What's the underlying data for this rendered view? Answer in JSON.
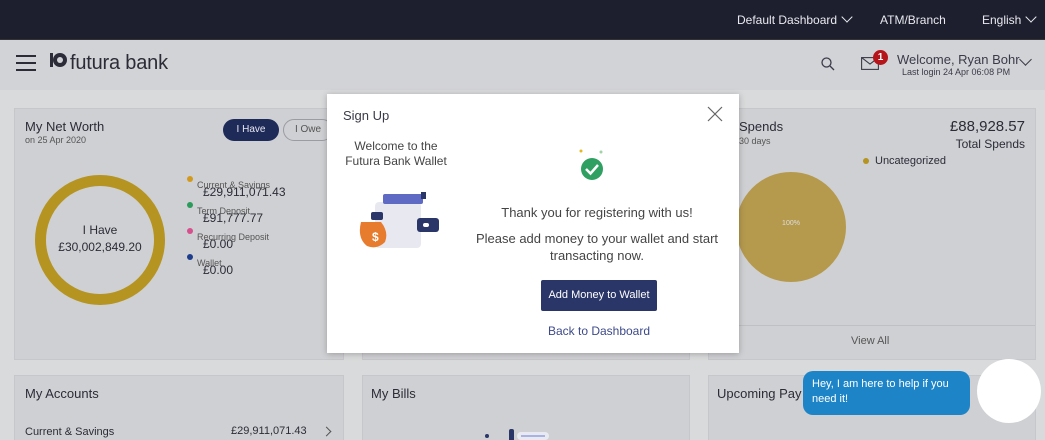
{
  "topbar": {
    "dashboard_label": "Default Dashboard",
    "atm_label": "ATM/Branch",
    "language_label": "English"
  },
  "header": {
    "logo_text": "futura bank",
    "notification_count": "1",
    "welcome_text": "Welcome, Ryan Bohr",
    "last_login": "Last login 24 Apr 06:08 PM"
  },
  "networth": {
    "title": "My Net Worth",
    "date": "on 25 Apr 2020",
    "toggle_have": "I Have",
    "toggle_owe": "I Owe",
    "donut_label": "I Have",
    "donut_value": "£30,002,849.20",
    "legend": [
      {
        "name": "Current & Savings",
        "value": "£29,911,071.43",
        "color": "#d29a1d"
      },
      {
        "name": "Term Deposit",
        "value": "£91,777.77",
        "color": "#2a9b5a"
      },
      {
        "name": "Recurring Deposit",
        "value": "£0.00",
        "color": "#d5508c"
      },
      {
        "name": "Wallet",
        "value": "£0.00",
        "color": "#1d3d8c"
      }
    ]
  },
  "spends": {
    "title": "Spends",
    "period": "30 days",
    "amount": "£88,928.57",
    "total_label": "Total Spends",
    "legend_label": "Uncategorized",
    "pie_percent": "100%",
    "view_all": "View All"
  },
  "accounts": {
    "title": "My Accounts",
    "row_name": "Current & Savings",
    "row_value": "£29,911,071.43"
  },
  "bills": {
    "title": "My Bills"
  },
  "upcoming": {
    "title": "Upcoming Pay"
  },
  "modal": {
    "title": "Sign Up",
    "welcome": "Welcome to the Futura Bank Wallet",
    "thanks": "Thank you for registering with us!",
    "please": "Please add money to your wallet and start transacting now.",
    "add_button": "Add Money to Wallet",
    "back_link": "Back to Dashboard"
  },
  "chat": {
    "message": "Hey, I am here to help if you need it!"
  },
  "colors": {
    "topbar": "#1d1f2e",
    "primary": "#2a3568",
    "gold": "#b59421",
    "chat": "#1e84c8"
  }
}
